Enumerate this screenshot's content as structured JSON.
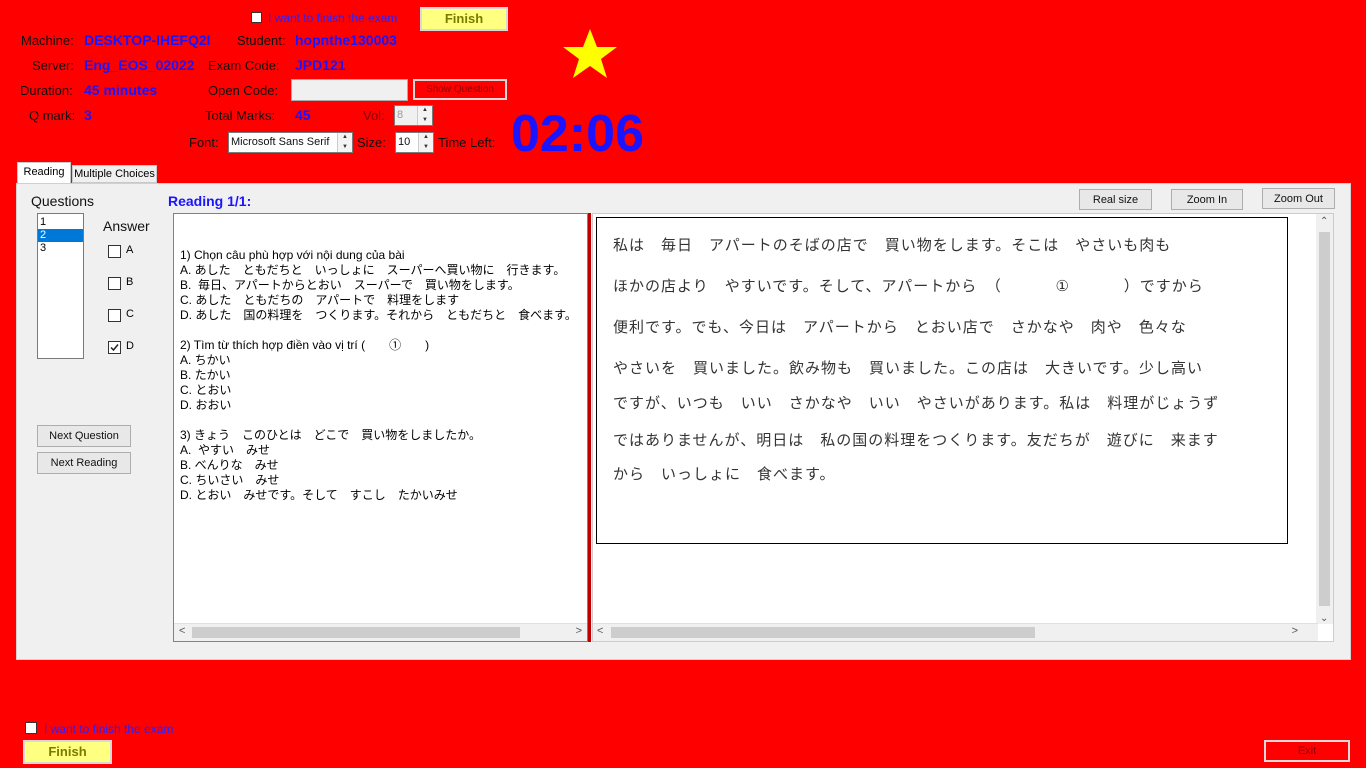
{
  "header": {
    "finish_check_label": "I want to finish the exam",
    "finish_button": "Finish",
    "machine_label": "Machine:",
    "machine_value": "DESKTOP-IHEFQ2I",
    "student_label": "Student:",
    "student_value": "hopnthe130003",
    "server_label": "Server:",
    "server_value": "Eng_EOS_02022",
    "exam_code_label": "Exam Code:",
    "exam_code_value": "JPD121",
    "duration_label": "Duration:",
    "duration_value": "45 minutes",
    "open_code_label": "Open Code:",
    "open_code_value": "",
    "show_question_button": "Show Question",
    "qmark_label": "Q mark:",
    "qmark_value": "3",
    "total_marks_label": "Total Marks:",
    "total_marks_value": "45",
    "vol_label": "Vol:",
    "vol_value": "8",
    "font_label": "Font:",
    "font_value": "Microsoft Sans Serif",
    "size_label": "Size:",
    "size_value": "10",
    "time_left_label": "Time Left:",
    "time_left_value": "02:06",
    "star_color": "#ffff00"
  },
  "tabs": [
    {
      "label": "Reading",
      "active": true
    },
    {
      "label": "Multiple Choices",
      "active": false
    }
  ],
  "questions_panel": {
    "title": "Questions",
    "items": [
      "1",
      "2",
      "3"
    ],
    "selected": "2",
    "answer_title": "Answer",
    "answers": [
      {
        "label": "A",
        "checked": false
      },
      {
        "label": "B",
        "checked": false
      },
      {
        "label": "C",
        "checked": false
      },
      {
        "label": "D",
        "checked": true
      }
    ],
    "next_question": "Next Question",
    "next_reading": "Next Reading"
  },
  "reading": {
    "title": "Reading 1/1:",
    "real_size": "Real size",
    "zoom_in": "Zoom In",
    "zoom_out": "Zoom Out"
  },
  "question_lines": [
    "1) Chọn câu phù hợp với nội dung của bài",
    "A. あした　ともだちと　いっしょに　スーパーへ買い物に　行きます。",
    "B.  毎日、アパートからとおい　スーパーで　買い物をします。",
    "C. あした　ともだちの　アパートで　料理をします",
    "D. あした　国の料理を　つくります。それから　ともだちと　食べます。",
    "",
    "2) Tìm từ thích hợp điền vào vị trí (　　①　　)",
    "A. ちかい",
    "B. たかい",
    "C. とおい",
    "D. おおい",
    "",
    "3) きょう　このひとは　どこで　買い物をしましたか。",
    "A.  やすい　みせ",
    "B. べんりな　みせ",
    "C. ちいさい　みせ",
    "D. とおい　みせです。そして　すこし　たかいみせ"
  ],
  "passage_lines": [
    "私は　毎日　アパートのそばの店で　買い物をします。そこは　やさいも肉も",
    "ほかの店より　やすいです。そして、アパートから　（ 　　　①　　　 ）ですから",
    "便利です。でも、今日は　アパートから　とおい店で　さかなや　肉や　色々な",
    "やさいを　買いました。飲み物も　買いました。この店は　大きいです。少し高い",
    "ですが、いつも　いい　さかなや　いい　やさいがあります。私は　料理がじょうず",
    "ではありませんが、明日は　私の国の料理をつくります。友だちが　遊びに　来ます",
    "から　いっしょに　食べます。"
  ],
  "footer": {
    "finish_check_label": "I want to finish the exam",
    "finish_button": "Finish",
    "exit_button": "Exit"
  }
}
